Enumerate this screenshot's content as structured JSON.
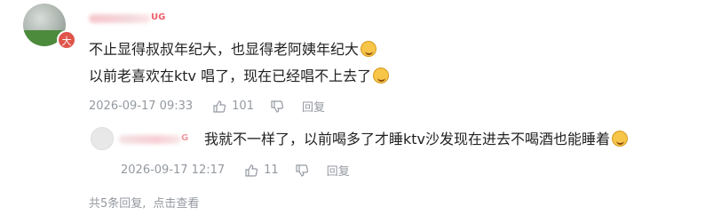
{
  "comment": {
    "level_badge": "大",
    "user_tag": "UG",
    "line1": "不止显得叔叔年纪大，也显得老阿姨年纪大",
    "line2": "以前老喜欢在ktv 唱了，现在已经唱不上去了",
    "timestamp": "2026-09-17 09:33",
    "likes": "101",
    "reply_label": "回复",
    "emoji_line1": "laughing-tears-emoji",
    "emoji_line2": "crying-emoji"
  },
  "reply": {
    "user_tag": "G",
    "text": "我就不一样了，以前喝多了才睡ktv沙发现在进去不喝酒也能睡着",
    "timestamp": "2026-09-17 12:17",
    "likes": "11",
    "reply_label": "回复",
    "emoji": "grin-emoji"
  },
  "footer": {
    "count_text": "共5条回复,",
    "view_text": "点击查看"
  },
  "colors": {
    "meta_gray": "#9499a0",
    "username_pink": "#ef5d6a",
    "badge_red": "#e0554b"
  }
}
